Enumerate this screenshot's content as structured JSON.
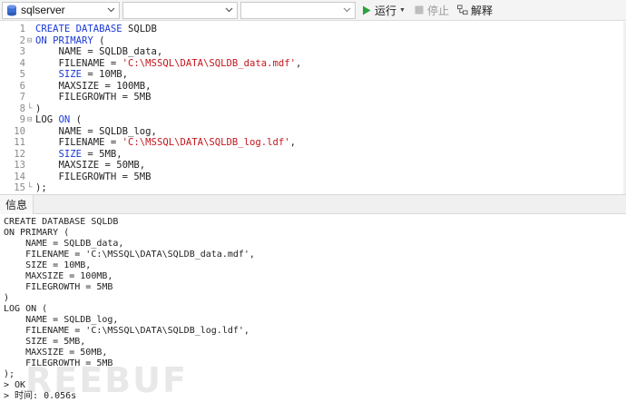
{
  "toolbar": {
    "connection": {
      "value": "sqlserver",
      "icon": "database-icon"
    },
    "database": {
      "value": ""
    },
    "schema": {
      "value": ""
    },
    "run_label": "运行",
    "stop_label": "停止",
    "explain_label": "解释",
    "colors": {
      "run": "#2aa33d",
      "stop": "#bdbdbd"
    }
  },
  "editor": {
    "lines": [
      {
        "n": "1",
        "fold": "",
        "segments": [
          {
            "t": "CREATE DATABASE",
            "c": "kw"
          },
          {
            "t": " SQLDB",
            "c": ""
          }
        ]
      },
      {
        "n": "2",
        "fold": "⊟",
        "segments": [
          {
            "t": "ON PRIMARY",
            "c": "kw"
          },
          {
            "t": " (",
            "c": ""
          }
        ]
      },
      {
        "n": "3",
        "fold": "",
        "segments": [
          {
            "t": "    NAME = SQLDB_data,",
            "c": ""
          }
        ]
      },
      {
        "n": "4",
        "fold": "",
        "segments": [
          {
            "t": "    FILENAME = ",
            "c": ""
          },
          {
            "t": "'C:\\MSSQL\\DATA\\SQLDB_data.mdf'",
            "c": "str"
          },
          {
            "t": ",",
            "c": ""
          }
        ]
      },
      {
        "n": "5",
        "fold": "",
        "segments": [
          {
            "t": "    ",
            "c": ""
          },
          {
            "t": "SIZE",
            "c": "kw"
          },
          {
            "t": " = 10MB,",
            "c": ""
          }
        ]
      },
      {
        "n": "6",
        "fold": "",
        "segments": [
          {
            "t": "    MAXSIZE = 100MB,",
            "c": ""
          }
        ]
      },
      {
        "n": "7",
        "fold": "",
        "segments": [
          {
            "t": "    FILEGROWTH = 5MB",
            "c": ""
          }
        ]
      },
      {
        "n": "8",
        "fold": "└",
        "segments": [
          {
            "t": ")",
            "c": ""
          }
        ]
      },
      {
        "n": "9",
        "fold": "⊟",
        "segments": [
          {
            "t": "LOG ",
            "c": ""
          },
          {
            "t": "ON",
            "c": "kw"
          },
          {
            "t": " (",
            "c": ""
          }
        ]
      },
      {
        "n": "10",
        "fold": "",
        "segments": [
          {
            "t": "    NAME = SQLDB_log,",
            "c": ""
          }
        ]
      },
      {
        "n": "11",
        "fold": "",
        "segments": [
          {
            "t": "    FILENAME = ",
            "c": ""
          },
          {
            "t": "'C:\\MSSQL\\DATA\\SQLDB_log.ldf'",
            "c": "str"
          },
          {
            "t": ",",
            "c": ""
          }
        ]
      },
      {
        "n": "12",
        "fold": "",
        "segments": [
          {
            "t": "    ",
            "c": ""
          },
          {
            "t": "SIZE",
            "c": "kw"
          },
          {
            "t": " = 5MB,",
            "c": ""
          }
        ]
      },
      {
        "n": "13",
        "fold": "",
        "segments": [
          {
            "t": "    MAXSIZE = 50MB,",
            "c": ""
          }
        ]
      },
      {
        "n": "14",
        "fold": "",
        "segments": [
          {
            "t": "    FILEGROWTH = 5MB",
            "c": ""
          }
        ]
      },
      {
        "n": "15",
        "fold": "└",
        "segments": [
          {
            "t": ");",
            "c": ""
          }
        ]
      }
    ]
  },
  "tabs": {
    "info_label": "信息"
  },
  "output": {
    "lines": [
      "CREATE DATABASE SQLDB",
      "ON PRIMARY (",
      "    NAME = SQLDB_data,",
      "    FILENAME = 'C:\\MSSQL\\DATA\\SQLDB_data.mdf',",
      "    SIZE = 10MB,",
      "    MAXSIZE = 100MB,",
      "    FILEGROWTH = 5MB",
      ")",
      "LOG ON (",
      "    NAME = SQLDB_log,",
      "    FILENAME = 'C:\\MSSQL\\DATA\\SQLDB_log.ldf',",
      "    SIZE = 5MB,",
      "    MAXSIZE = 50MB,",
      "    FILEGROWTH = 5MB",
      ");",
      "> OK",
      "> 时间: 0.056s"
    ]
  },
  "watermark": {
    "text": "REEBUF"
  }
}
